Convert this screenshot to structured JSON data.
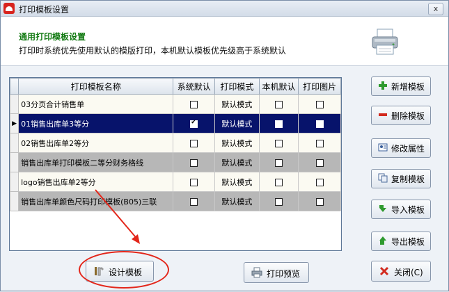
{
  "window": {
    "title": "打印模板设置",
    "close_glyph": "x"
  },
  "header": {
    "title": "通用打印模板设置",
    "subtitle": "打印时系统优先使用默认的模版打印，本机默认模板优先级高于系统默认"
  },
  "table": {
    "columns": [
      "打印模板名称",
      "系统默认",
      "打印模式",
      "本机默认",
      "打印图片"
    ],
    "rows": [
      {
        "name": "03分页合计销售单",
        "system_default": false,
        "mode": "",
        "local_default": false,
        "print_image": false
      },
      {
        "name": "01销售出库单3等分",
        "system_default": true,
        "mode": "默认模式",
        "local_default": false,
        "print_image": false,
        "selected": true
      },
      {
        "name": "02销售出库单2等分",
        "system_default": false,
        "mode": "默认模式",
        "local_default": false,
        "print_image": false
      },
      {
        "name": "销售出库单打印模板二等分财务格线",
        "system_default": false,
        "mode": "默认模式",
        "local_default": false,
        "print_image": false
      },
      {
        "name": "logo销售出库单2等分",
        "system_default": false,
        "mode": "默认模式",
        "local_default": false,
        "print_image": false
      },
      {
        "name": "销售出库单颜色尺码打印模板(B05)三联",
        "system_default": false,
        "mode": "默认模式",
        "local_default": false,
        "print_image": false
      }
    ],
    "first_row_mode": "默认模式"
  },
  "buttons": {
    "add": "新增模板",
    "delete": "删除模板",
    "edit": "修改属性",
    "copy": "复制模板",
    "import": "导入模板",
    "export": "导出模板",
    "design": "设计模板",
    "preview": "打印预览",
    "close": "关闭(C)"
  },
  "colors": {
    "selected_row": "#07136b",
    "header_title": "#127a12",
    "annotation": "#e3261a"
  }
}
